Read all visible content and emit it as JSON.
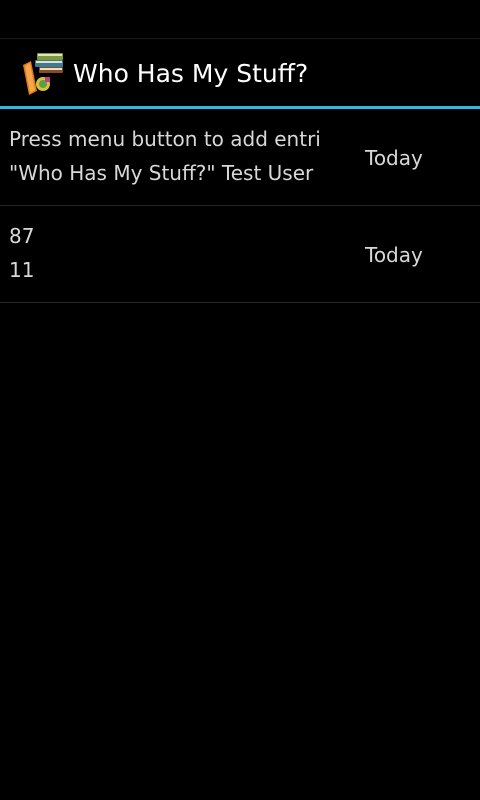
{
  "action_bar": {
    "title": "Who Has My Stuff?",
    "icon": "books-app-icon"
  },
  "entries": [
    {
      "line1": "Press menu button to add entri…",
      "line2": "\"Who Has My Stuff?\" Test User",
      "date": "Today"
    },
    {
      "line1": "87",
      "line2": "11",
      "date": "Today"
    }
  ],
  "colors": {
    "background": "#000000",
    "accent": "#33b5e5",
    "text": "#d8d8d8"
  }
}
